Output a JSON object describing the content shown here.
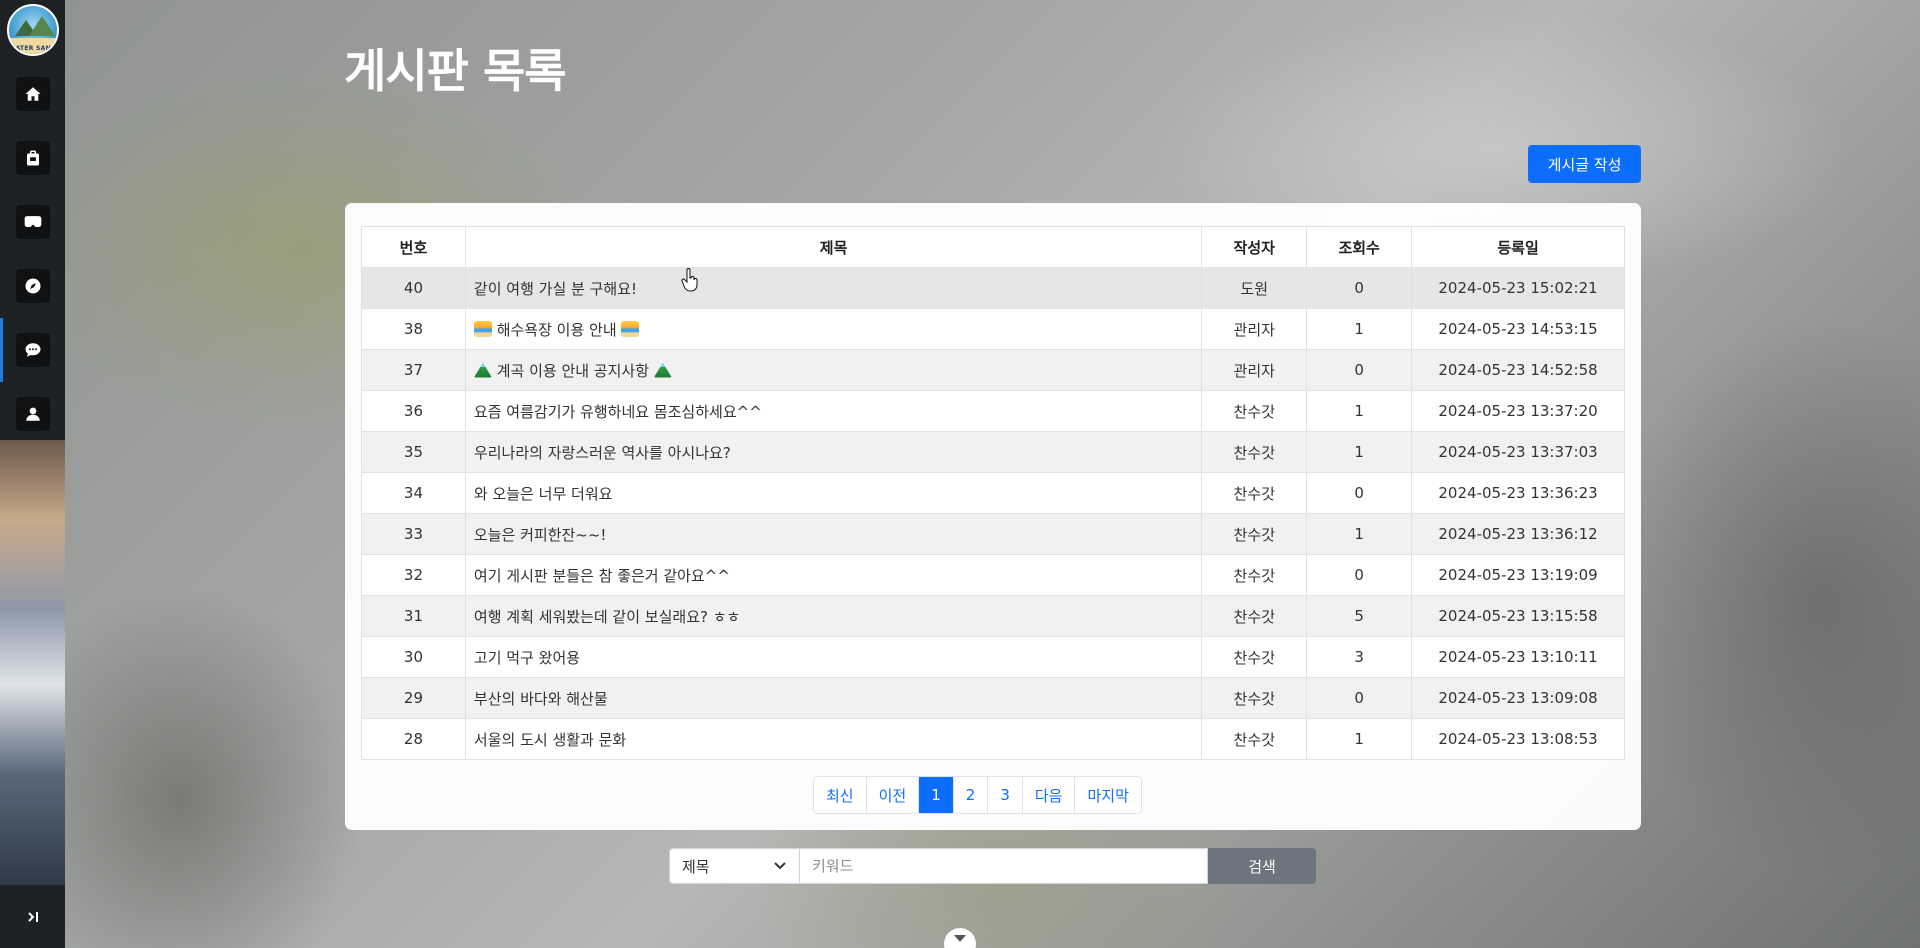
{
  "logo": {
    "text": "WATER SAND"
  },
  "sidebar": {
    "items": [
      {
        "name": "home",
        "icon": "home-icon"
      },
      {
        "name": "accommodation",
        "icon": "bag-icon"
      },
      {
        "name": "vr",
        "icon": "goggles-icon"
      },
      {
        "name": "explore",
        "icon": "compass-icon"
      },
      {
        "name": "board",
        "icon": "chat-icon",
        "active": true
      },
      {
        "name": "profile",
        "icon": "user-icon"
      }
    ],
    "toggle_icon": "sidebar-expand-icon"
  },
  "page": {
    "title": "게시판 목록",
    "write_button_label": "게시글 작성"
  },
  "table": {
    "headers": [
      "번호",
      "제목",
      "작성자",
      "조회수",
      "등록일"
    ],
    "rows": [
      {
        "no": "40",
        "title": "같이 여행 가실 분 구해요!",
        "author": "도원",
        "views": "0",
        "date": "2024-05-23 15:02:21"
      },
      {
        "no": "38",
        "title": "해수욕장 이용 안내",
        "author": "관리자",
        "views": "1",
        "date": "2024-05-23 14:53:15",
        "emoji": "beach"
      },
      {
        "no": "37",
        "title": "계곡 이용 안내 공지사항",
        "author": "관리자",
        "views": "0",
        "date": "2024-05-23 14:52:58",
        "emoji": "mount"
      },
      {
        "no": "36",
        "title": "요즘 여름감기가 유행하네요 몸조심하세요^^",
        "author": "찬수갓",
        "views": "1",
        "date": "2024-05-23 13:37:20"
      },
      {
        "no": "35",
        "title": "우리나라의 자랑스러운 역사를 아시나요?",
        "author": "찬수갓",
        "views": "1",
        "date": "2024-05-23 13:37:03"
      },
      {
        "no": "34",
        "title": "와 오늘은 너무 더워요",
        "author": "찬수갓",
        "views": "0",
        "date": "2024-05-23 13:36:23"
      },
      {
        "no": "33",
        "title": "오늘은 커피한잔~~!",
        "author": "찬수갓",
        "views": "1",
        "date": "2024-05-23 13:36:12"
      },
      {
        "no": "32",
        "title": "여기 게시판 분들은 참 좋은거 같아요^^",
        "author": "찬수갓",
        "views": "0",
        "date": "2024-05-23 13:19:09"
      },
      {
        "no": "31",
        "title": "여행 계획 세워봤는데 같이 보실래요? ㅎㅎ",
        "author": "찬수갓",
        "views": "5",
        "date": "2024-05-23 13:15:58"
      },
      {
        "no": "30",
        "title": "고기 먹구 왔어용",
        "author": "찬수갓",
        "views": "3",
        "date": "2024-05-23 13:10:11"
      },
      {
        "no": "29",
        "title": "부산의 바다와 해산물",
        "author": "찬수갓",
        "views": "0",
        "date": "2024-05-23 13:09:08"
      },
      {
        "no": "28",
        "title": "서울의 도시 생활과 문화",
        "author": "찬수갓",
        "views": "1",
        "date": "2024-05-23 13:08:53"
      }
    ]
  },
  "pagination": {
    "first": "최신",
    "prev": "이전",
    "pages": [
      "1",
      "2",
      "3"
    ],
    "current": "1",
    "next": "다음",
    "last": "마지막"
  },
  "search": {
    "field_selected": "제목",
    "placeholder": "키워드",
    "button_label": "검색"
  },
  "colors": {
    "primary": "#0d6efd",
    "sidebar": "#1f2224",
    "search_button": "#6c757d"
  }
}
